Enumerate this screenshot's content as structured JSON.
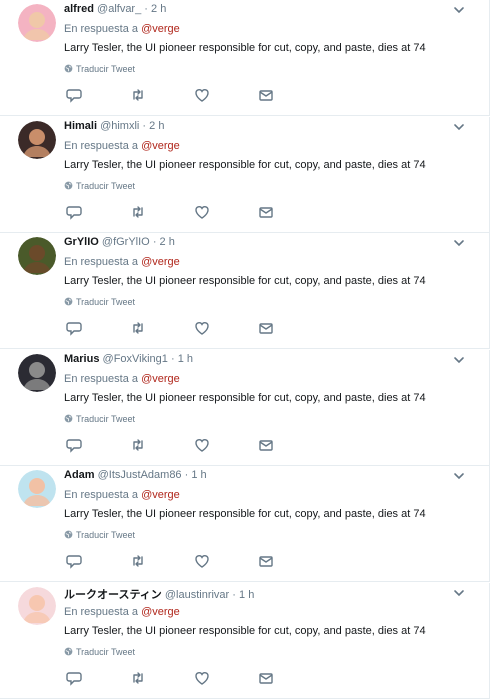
{
  "common": {
    "reply_prefix": "En respuesta a",
    "translate_label": "Traducir Tweet",
    "dot": "·"
  },
  "tweets": [
    {
      "name": "alfred",
      "handle": "@alfvar_",
      "time": "2 h",
      "mention": "@verge",
      "text": "Larry Tesler, the UI pioneer responsible for cut, copy, and paste, dies at 74",
      "avatar_color": "#f4b3c2"
    },
    {
      "name": "Himali",
      "handle": "@himxli",
      "time": "2 h",
      "mention": "@verge",
      "text": "Larry Tesler, the UI pioneer responsible for cut, copy, and paste, dies at 74",
      "avatar_color": "#3b2a28"
    },
    {
      "name": "GrYlIO",
      "handle": "@fGrYlIO",
      "time": "2 h",
      "mention": "@verge",
      "text": "Larry Tesler, the UI pioneer responsible for cut, copy, and paste, dies at 74",
      "avatar_color": "#4a5a2a"
    },
    {
      "name": "Marius",
      "handle": "@FoxViking1",
      "time": "1 h",
      "mention": "@verge",
      "text": "Larry Tesler, the UI pioneer responsible for cut, copy, and paste, dies at 74",
      "avatar_color": "#2b2b33"
    },
    {
      "name": "Adam",
      "handle": "@ItsJustAdam86",
      "time": "1 h",
      "mention": "@verge",
      "text": "Larry Tesler, the UI pioneer responsible for cut, copy, and paste, dies at 74",
      "avatar_color": "#bfe3ef"
    },
    {
      "name": "ルークオースティン",
      "handle": "@laustinrivar",
      "time": "1 h",
      "mention": "@verge",
      "text": "Larry Tesler, the UI pioneer responsible for cut, copy, and paste, dies at 74",
      "avatar_color": "#f6d9dc"
    }
  ],
  "colors": {
    "mention": "#b0261b",
    "muted": "#657786",
    "divider": "#e6ecf0"
  }
}
